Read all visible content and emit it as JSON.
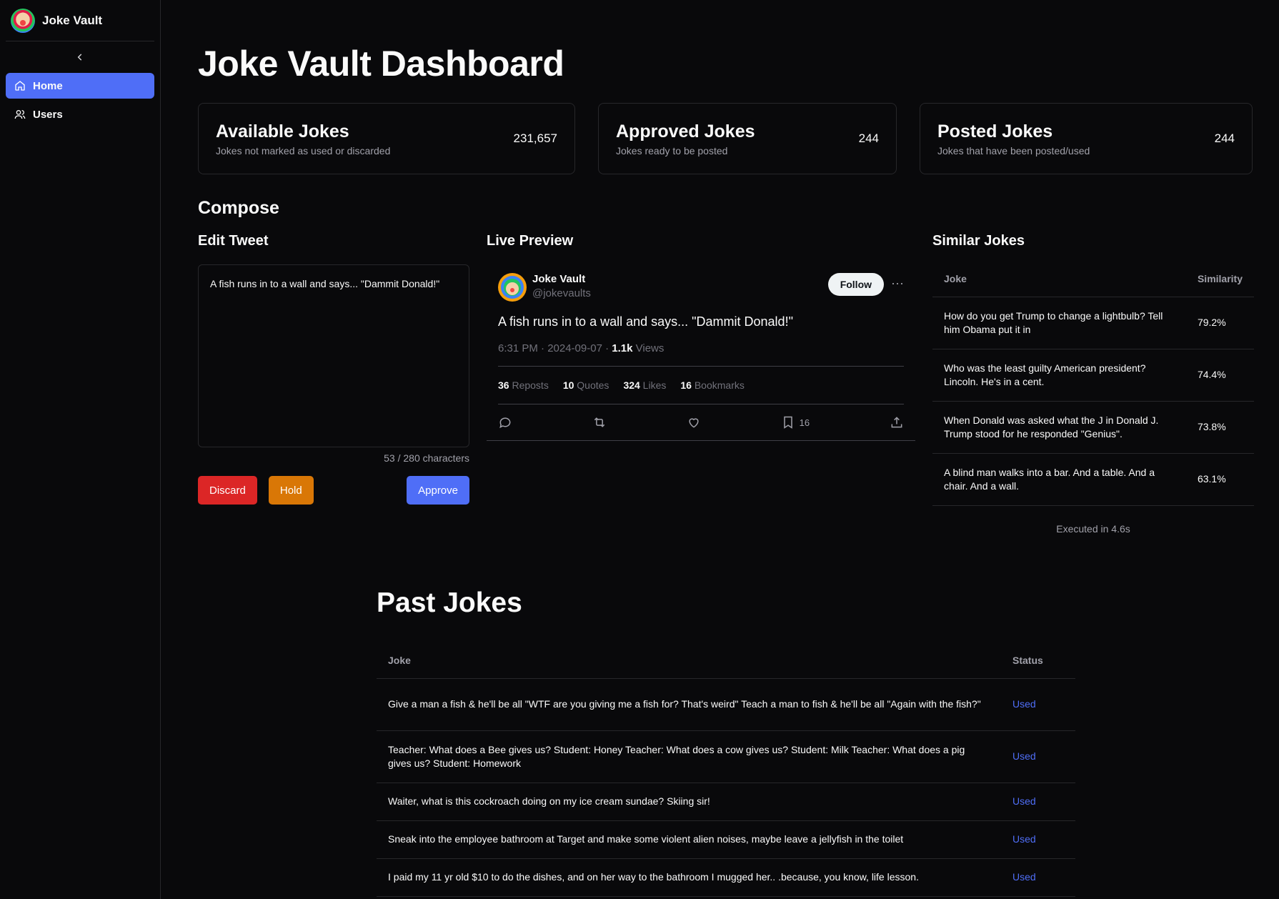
{
  "sidebar": {
    "brand": "Joke Vault",
    "collapse_icon": "chevron-left-icon",
    "items": [
      {
        "label": "Home",
        "icon": "home-icon",
        "active": true
      },
      {
        "label": "Users",
        "icon": "users-icon",
        "active": false
      }
    ]
  },
  "page": {
    "title": "Joke Vault Dashboard"
  },
  "stats": [
    {
      "title": "Available Jokes",
      "desc": "Jokes not marked as used or discarded",
      "value": "231,657"
    },
    {
      "title": "Approved Jokes",
      "desc": "Jokes ready to be posted",
      "value": "244"
    },
    {
      "title": "Posted Jokes",
      "desc": "Jokes that have been posted/used",
      "value": "244"
    }
  ],
  "compose": {
    "title": "Compose",
    "edit": {
      "title": "Edit Tweet",
      "value": "A fish runs in to a wall and says... \"Dammit Donald!\"",
      "char_count": "53 / 280 characters",
      "discard": "Discard",
      "hold": "Hold",
      "approve": "Approve"
    },
    "preview": {
      "title": "Live Preview",
      "name": "Joke Vault",
      "handle": "@jokevaults",
      "follow": "Follow",
      "more": "···",
      "text": "A fish runs in to a wall and says... \"Dammit Donald!\"",
      "meta_time": "6:31 PM · 2024-09-07 · ",
      "meta_views_num": "1.1k",
      "meta_views_label": " Views",
      "reposts": "36",
      "reposts_label": " Reposts",
      "quotes": "10",
      "quotes_label": " Quotes",
      "likes": "324",
      "likes_label": " Likes",
      "bookmarks": "16",
      "bookmarks_label": " Bookmarks",
      "bookmark_count": "16"
    },
    "similar": {
      "title": "Similar Jokes",
      "col_joke": "Joke",
      "col_similarity": "Similarity",
      "rows": [
        {
          "joke": "How do you get Trump to change a lightbulb? Tell him Obama put it in",
          "similarity": "79.2%"
        },
        {
          "joke": "Who was the least guilty American president? Lincoln. He's in a cent.",
          "similarity": "74.4%"
        },
        {
          "joke": "When Donald was asked what the J in Donald J. Trump stood for he responded \"Genius\".",
          "similarity": "73.8%"
        },
        {
          "joke": "A blind man walks into a bar. And a table. And a chair. And a wall.",
          "similarity": "63.1%"
        }
      ],
      "executed": "Executed in 4.6s"
    }
  },
  "past": {
    "title": "Past Jokes",
    "col_joke": "Joke",
    "col_status": "Status",
    "rows": [
      {
        "joke": "Give a man a fish & he'll be all \"WTF are you giving me a fish for? That's weird\" Teach a man to fish & he'll be all \"Again with the fish?\"",
        "status": "Used"
      },
      {
        "joke": "Teacher: What does a Bee gives us? Student: Honey Teacher: What does a cow gives us? Student: Milk Teacher: What does a pig gives us? Student: Homework",
        "status": "Used"
      },
      {
        "joke": "Waiter, what is this cockroach doing on my ice cream sundae? Skiing sir!",
        "status": "Used"
      },
      {
        "joke": "Sneak into the employee bathroom at Target and make some violent alien noises, maybe leave a jellyfish in the toilet",
        "status": "Used"
      },
      {
        "joke": "I paid my 11 yr old $10 to do the dishes, and on her way to the bathroom I mugged her.. .because, you know, life lesson.",
        "status": "Used"
      }
    ]
  },
  "colors": {
    "accent": "#4f6ef7",
    "discard": "#dc2626",
    "hold": "#d97706",
    "background": "#09090b"
  }
}
